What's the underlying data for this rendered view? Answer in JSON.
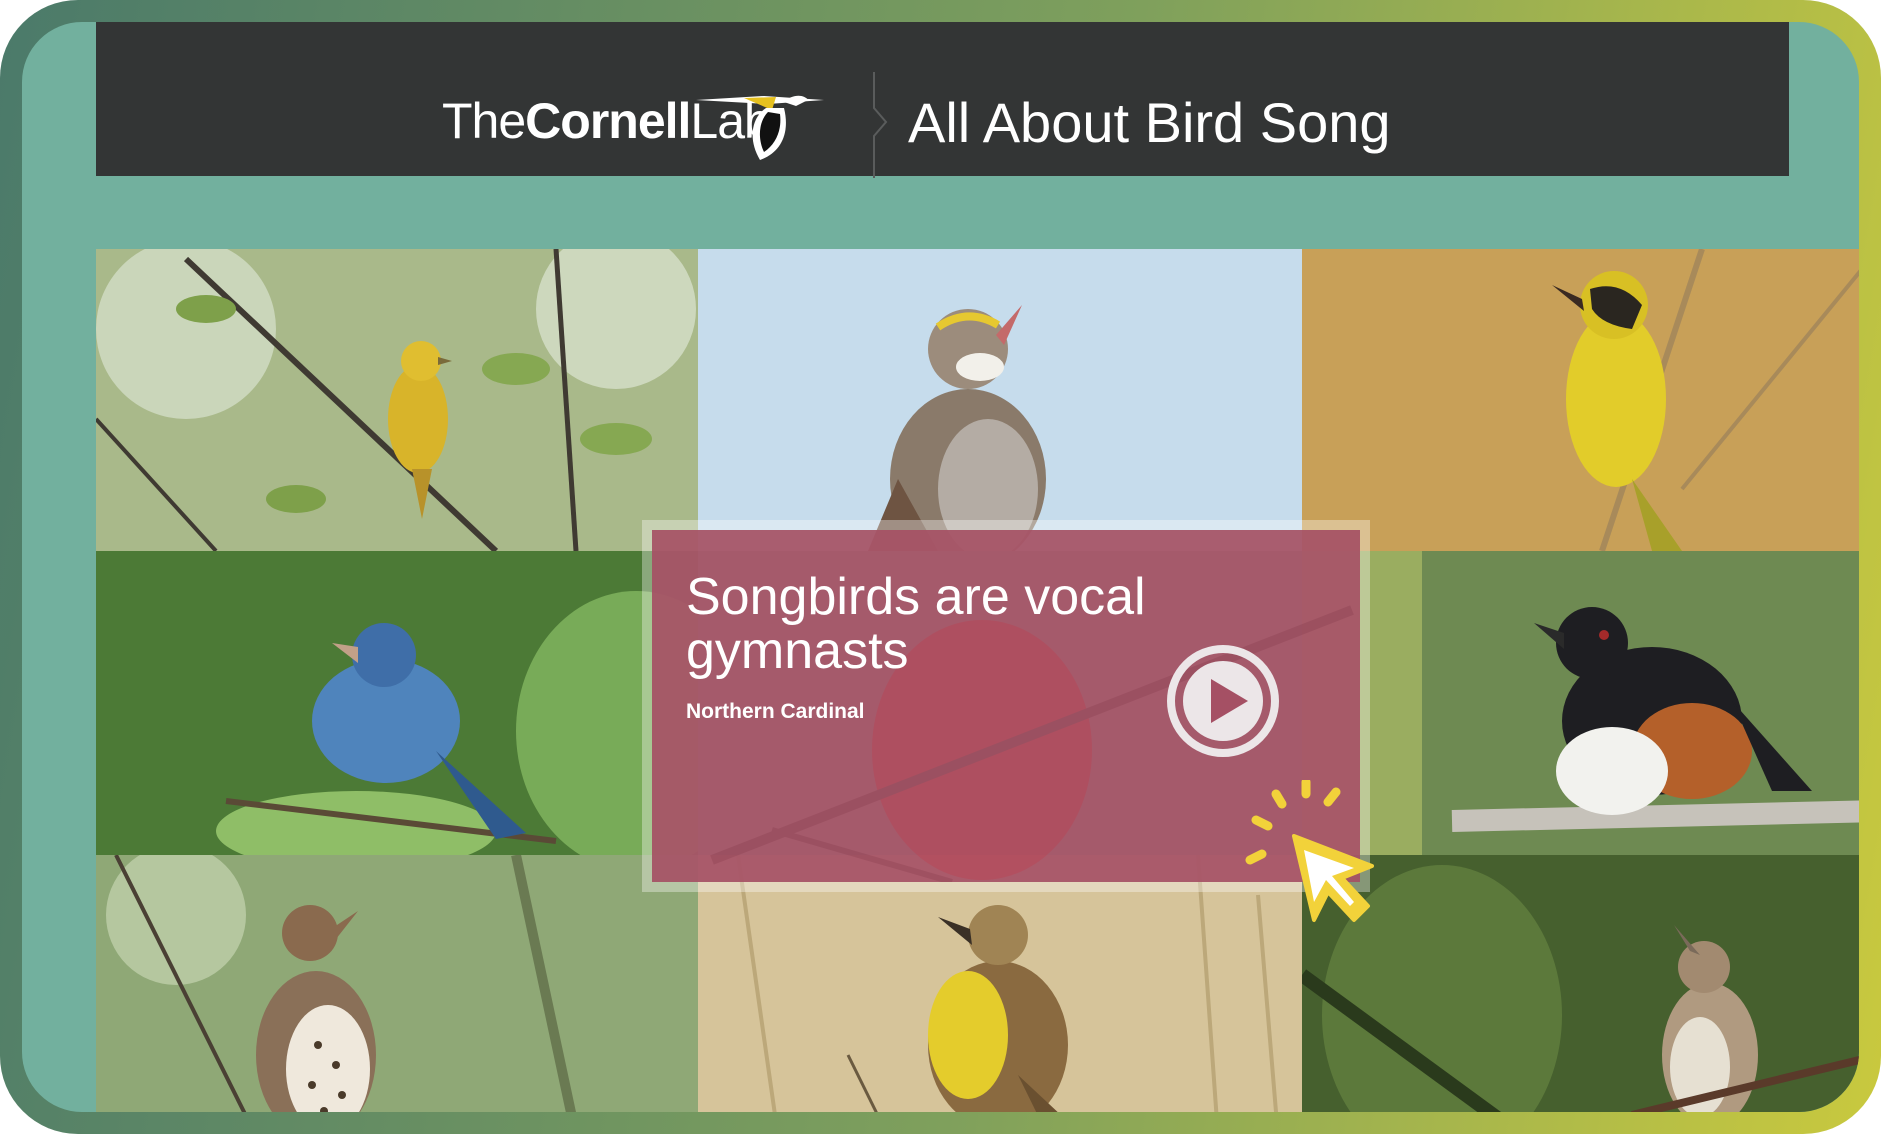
{
  "header": {
    "logo_light": "The",
    "logo_bold": "Cornell",
    "logo_light_2": "Lab",
    "title": "All About Bird Song"
  },
  "feature_card": {
    "heading": "Songbirds are vocal gymnasts",
    "species": "Northern Cardinal",
    "play_icon": "play-circle-icon"
  },
  "tiles": [
    {
      "name": "yellow-warbler-photo",
      "bg": "#a9b98a",
      "bird": "#d8b42a"
    },
    {
      "name": "white-throated-sparrow-photo",
      "bg": "#c6dcec",
      "bird": "#8a7a6a"
    },
    {
      "name": "common-yellowthroat-photo",
      "bg": "#c8a058",
      "bird": "#e2cc2a"
    },
    {
      "name": "indigo-bunting-photo",
      "bg": "#4c7a36",
      "bird": "#4f84bc"
    },
    {
      "name": "eastern-towhee-photo",
      "bg": "#6e8a52",
      "bird": "#1e1e22"
    },
    {
      "name": "wood-thrush-photo",
      "bg": "#8fa876",
      "bird": "#8a7058"
    },
    {
      "name": "western-meadowlark-photo",
      "bg": "#d6c49a",
      "bird": "#e4cc2c"
    },
    {
      "name": "house-wren-photo",
      "bg": "#46602e",
      "bird": "#b09a80"
    }
  ],
  "colors": {
    "frame_gradient_start": "#4b7a6a",
    "frame_gradient_end": "#c9c93e",
    "inner_background": "#72b09e",
    "header_background": "#333535",
    "card_background": "#a55064",
    "cursor_accent": "#f2d23a"
  },
  "cursor_icon": "pointer-click-icon"
}
